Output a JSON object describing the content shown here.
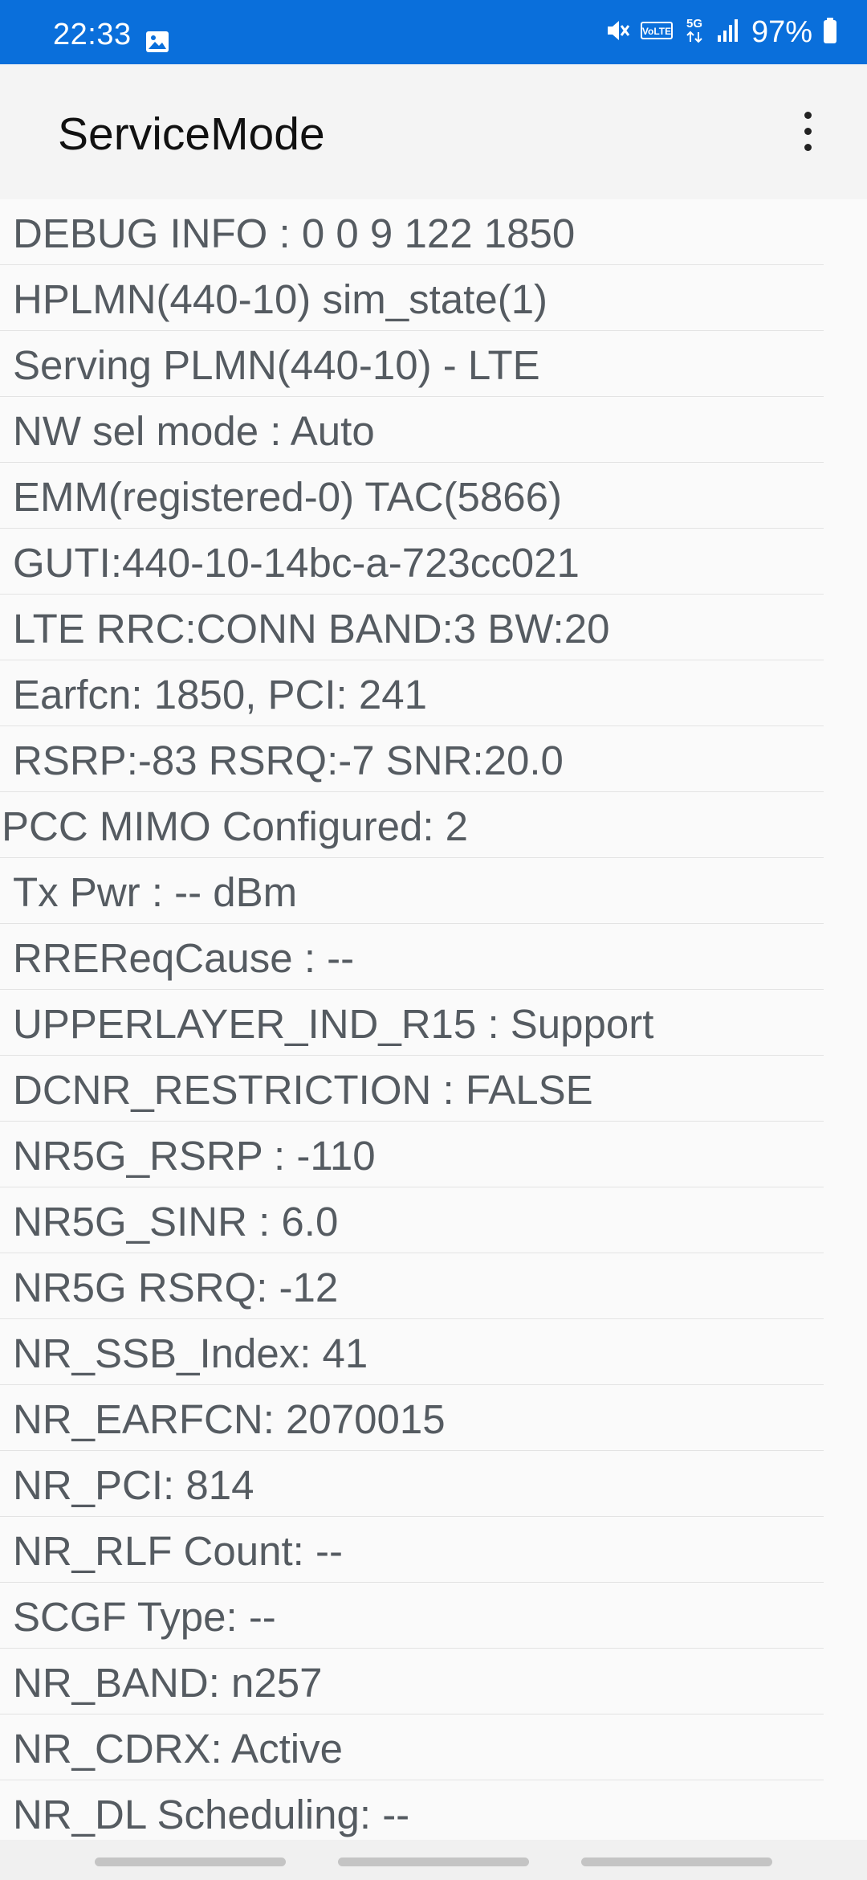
{
  "status_bar": {
    "time": "22:33",
    "battery_percent": "97%",
    "network_type": "5G",
    "volte_label": "VoLTE",
    "icons": [
      "gallery-icon",
      "mute-icon",
      "volte-icon",
      "5g-icon",
      "signal-icon",
      "battery-icon"
    ],
    "background_color": "#0a6fdb"
  },
  "app_bar": {
    "title": "ServiceMode",
    "overflow_icon": "more-vert-icon"
  },
  "info_rows": [
    "DEBUG INFO : 0 0 9 122 1850",
    "HPLMN(440-10) sim_state(1)",
    "Serving PLMN(440-10) - LTE",
    "NW sel mode : Auto",
    "EMM(registered-0) TAC(5866)",
    "GUTI:440-10-14bc-a-723cc021",
    "LTE RRC:CONN BAND:3 BW:20",
    "Earfcn: 1850, PCI: 241",
    "RSRP:-83 RSRQ:-7 SNR:20.0",
    "PCC MIMO Configured: 2",
    "Tx Pwr : -- dBm",
    "RREReqCause : --",
    "UPPERLAYER_IND_R15 : Support",
    "DCNR_RESTRICTION : FALSE",
    "NR5G_RSRP : -110",
    "NR5G_SINR : 6.0",
    "NR5G RSRQ: -12",
    "NR_SSB_Index: 41",
    "NR_EARFCN: 2070015",
    "NR_PCI: 814",
    "NR_RLF Count: --",
    "SCGF Type: --",
    "NR_BAND: n257",
    "NR_CDRX: Active",
    "NR_DL Scheduling: --"
  ]
}
